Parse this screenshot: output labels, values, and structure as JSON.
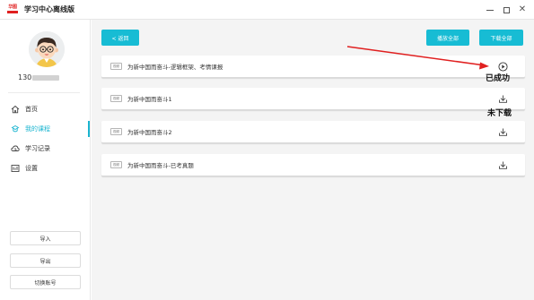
{
  "app": {
    "logo_text": "华图",
    "title": "华图学习中心离线版",
    "title_display": "学习中心离线版"
  },
  "window_controls": [
    "minimize",
    "maximize",
    "close"
  ],
  "user": {
    "phone_visible": "130",
    "avatar": "cartoon-boy-avatar"
  },
  "nav": [
    {
      "label": "首页",
      "icon": "home-icon",
      "active": false
    },
    {
      "label": "我的课程",
      "icon": "course-icon",
      "active": true
    },
    {
      "label": "学习记录",
      "icon": "record-icon",
      "active": false
    },
    {
      "label": "设置",
      "icon": "settings-icon",
      "active": false
    }
  ],
  "sidebar_buttons": {
    "import": "导入",
    "export": "导出",
    "switch_account": "切换账号"
  },
  "toolbar": {
    "back": "< 返回",
    "play_all": "播放全部",
    "download_all": "下载全部"
  },
  "courses": [
    {
      "tag": "视频",
      "title": "为新中国而奋斗-逻辑框架、考情课报",
      "action": "play-icon"
    },
    {
      "tag": "视频",
      "title": "为新中国而奋斗1",
      "action": "download-icon"
    },
    {
      "tag": "视频",
      "title": "为新中国而奋斗2",
      "action": "download-icon"
    },
    {
      "tag": "视频",
      "title": "为新中国而奋斗-已考真题",
      "action": "download-icon"
    }
  ],
  "annotations": {
    "success": "已成功",
    "not_downloaded": "未下载"
  },
  "colors": {
    "accent": "#17bcd4",
    "logo_red": "#e02020",
    "annotation_arrow": "#e02020",
    "main_bg": "#f4f4f4"
  }
}
